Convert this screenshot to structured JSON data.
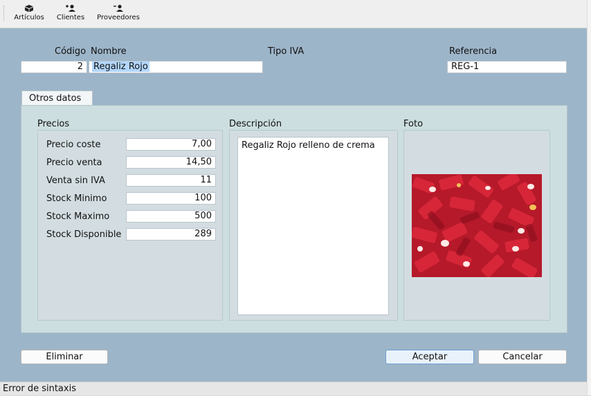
{
  "toolbar": {
    "items": [
      {
        "label": "Artículos",
        "icon": "box-icon"
      },
      {
        "label": "Clientes",
        "icon": "add-user-icon"
      },
      {
        "label": "Proveedores",
        "icon": "remove-user-icon"
      }
    ]
  },
  "form": {
    "codigo_label": "Código",
    "nombre_label": "Nombre",
    "tipo_iva_label": "Tipo IVA",
    "referencia_label": "Referencia",
    "codigo_value": "2",
    "nombre_value": "Regaliz Rojo",
    "referencia_value": "REG-1"
  },
  "tab": {
    "label": "Otros datos"
  },
  "precios": {
    "title": "Precios",
    "rows": [
      {
        "label": "Precio coste",
        "value": "7,00"
      },
      {
        "label": "Precio venta",
        "value": "14,50"
      },
      {
        "label": "Venta sin IVA",
        "value": "11"
      },
      {
        "label": "Stock Minimo",
        "value": "100"
      },
      {
        "label": "Stock Maximo",
        "value": "500"
      },
      {
        "label": "Stock Disponible",
        "value": "289"
      }
    ]
  },
  "descripcion": {
    "title": "Descripción",
    "text": "Regaliz Rojo relleno de crema"
  },
  "foto": {
    "title": "Foto"
  },
  "buttons": {
    "eliminar": "Eliminar",
    "aceptar": "Aceptar",
    "cancelar": "Cancelar"
  },
  "status": {
    "text": "Error de sintaxis"
  },
  "colors": {
    "background": "#9db5c9",
    "panel": "#ccdedf",
    "selection": "#b3d7ff"
  }
}
